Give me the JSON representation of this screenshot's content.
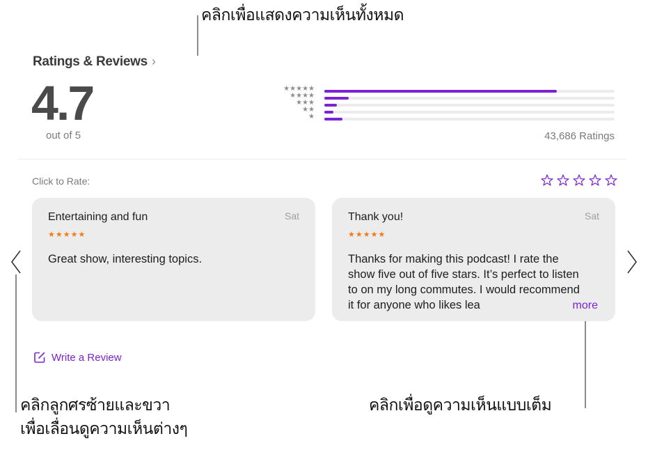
{
  "callouts": {
    "top": "คลิกเพื่อแสดงความเห็นทั้งหมด",
    "bottom_left_line1": "คลิกลูกศรซ้ายและขวา",
    "bottom_left_line2": "เพื่อเลื่อนดูความเห็นต่างๆ",
    "bottom_right": "คลิกเพื่อดูความเห็นแบบเต็ม"
  },
  "ratings": {
    "section_title": "Ratings & Reviews",
    "chevron_icon": "›",
    "average": "4.7",
    "out_of": "out of 5",
    "count_label": "43,686 Ratings",
    "accent_color": "#7b22d4",
    "distribution": [
      {
        "stars": 5,
        "label": "★★★★★",
        "fraction": 0.8
      },
      {
        "stars": 4,
        "label": "★★★★",
        "fraction": 0.084
      },
      {
        "stars": 3,
        "label": "★★★",
        "fraction": 0.043
      },
      {
        "stars": 2,
        "label": "★★",
        "fraction": 0.031
      },
      {
        "stars": 1,
        "label": "★",
        "fraction": 0.062
      }
    ]
  },
  "rate": {
    "label": "Click to Rate:",
    "star_count": 5
  },
  "reviews": [
    {
      "title": "Entertaining and fun",
      "date": "Sat",
      "stars": "★★★★★",
      "body": "Great show, interesting topics."
    },
    {
      "title": "Thank you!",
      "date": "Sat",
      "stars": "★★★★★",
      "body": "Thanks for making this podcast! I rate the show five out of five stars. It’s perfect to listen to on my long commutes. I would recommend it for anyone who likes lea",
      "more_label": "more"
    }
  ],
  "navigation": {
    "prev_icon": "chevron-left",
    "next_icon": "chevron-right"
  },
  "write_review": {
    "label": "Write a Review",
    "icon": "compose-icon"
  }
}
